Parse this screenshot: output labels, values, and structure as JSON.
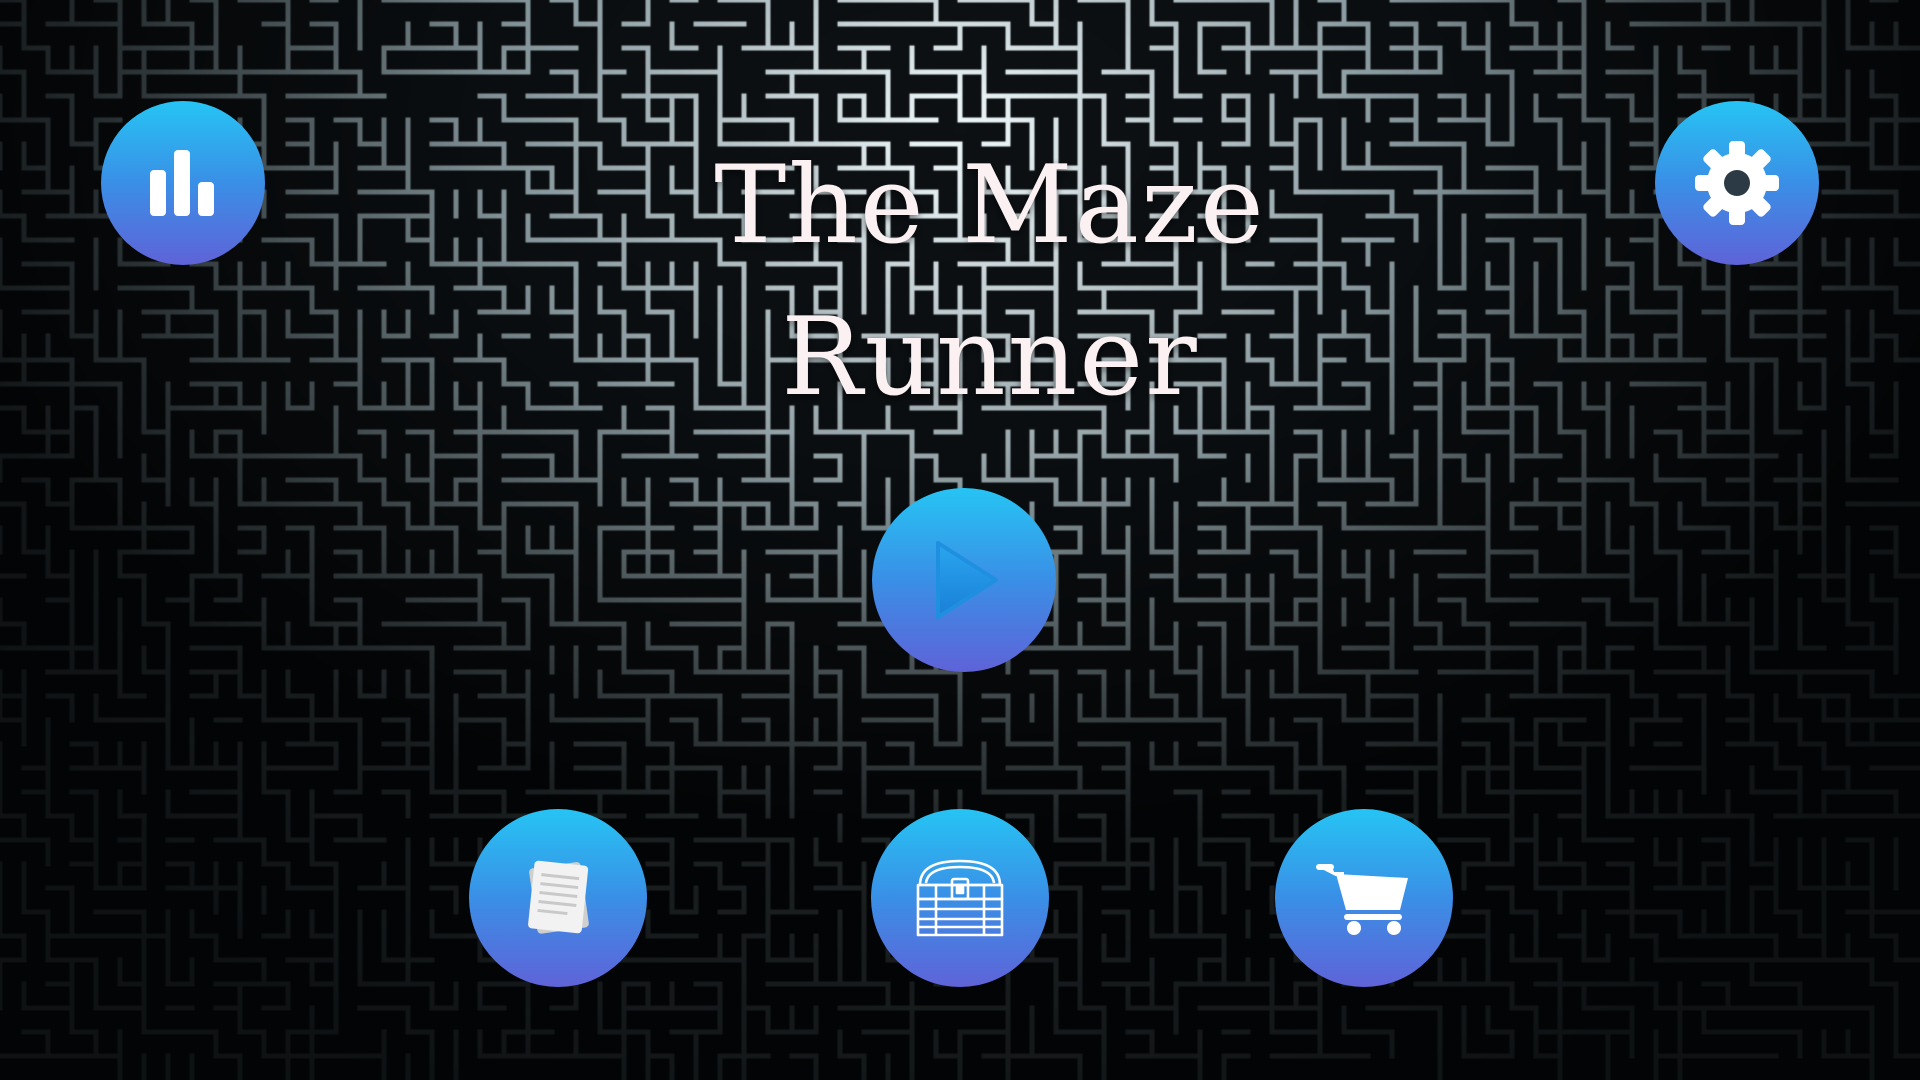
{
  "title": {
    "line1": "The Maze",
    "line2": "Runner"
  },
  "colors": {
    "title_text": "#fbf1f2",
    "ring_top": "#26c4f4",
    "ring_bottom": "#5f63d8",
    "play_triangle": "#1f8fe0",
    "icon_white": "#ffffff",
    "maze_wall": "#9fb0b6",
    "background": "#0d1114"
  },
  "buttons": {
    "stats": {
      "icon": "bar-chart-icon"
    },
    "settings": {
      "icon": "gear-icon"
    },
    "play": {
      "icon": "play-triangle-icon"
    },
    "notes": {
      "icon": "paper-notes-icon"
    },
    "chest": {
      "icon": "treasure-chest-icon"
    },
    "shop": {
      "icon": "shopping-cart-icon"
    }
  }
}
